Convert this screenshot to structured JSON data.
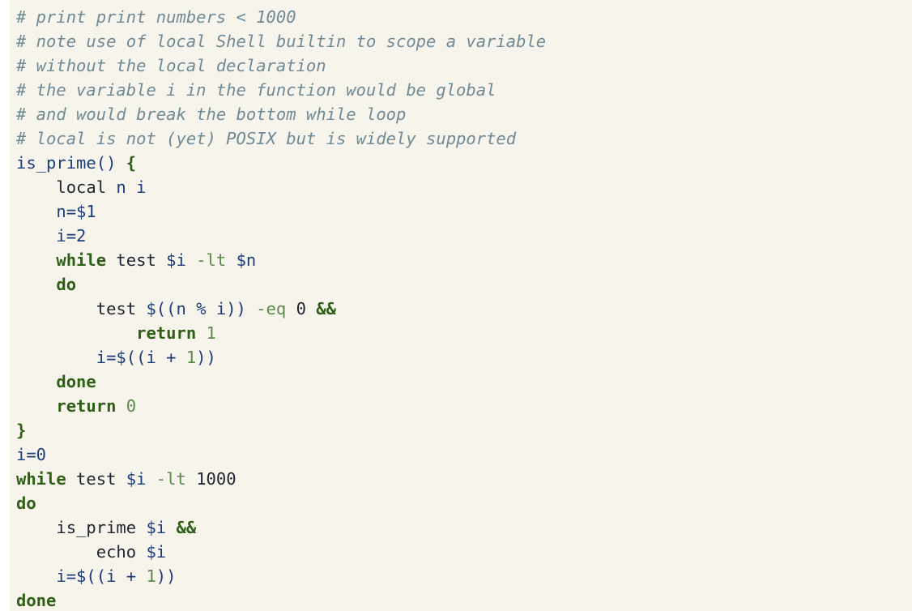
{
  "code": {
    "lines": [
      [
        {
          "t": "# print print numbers < 1000",
          "c": "comment"
        }
      ],
      [
        {
          "t": "# note use of local Shell builtin to scope a variable",
          "c": "comment"
        }
      ],
      [
        {
          "t": "# without the local declaration",
          "c": "comment"
        }
      ],
      [
        {
          "t": "# the variable i in the function would be global",
          "c": "comment"
        }
      ],
      [
        {
          "t": "# and would break the bottom while loop",
          "c": "comment"
        }
      ],
      [
        {
          "t": "# local is not (yet) POSIX but is widely supported",
          "c": "comment"
        }
      ],
      [
        {
          "t": "is_prime() ",
          "c": "fn"
        },
        {
          "t": "{",
          "c": "brace"
        }
      ],
      [
        {
          "t": "    local ",
          "c": "plain"
        },
        {
          "t": "n i",
          "c": "var"
        }
      ],
      [
        {
          "t": "    n=$1",
          "c": "var"
        }
      ],
      [
        {
          "t": "    i=2",
          "c": "var"
        }
      ],
      [
        {
          "t": "    ",
          "c": "plain"
        },
        {
          "t": "while",
          "c": "kw"
        },
        {
          "t": " test ",
          "c": "plain"
        },
        {
          "t": "$i",
          "c": "var"
        },
        {
          "t": " -lt ",
          "c": "op"
        },
        {
          "t": "$n",
          "c": "var"
        }
      ],
      [
        {
          "t": "    ",
          "c": "plain"
        },
        {
          "t": "do",
          "c": "kw"
        }
      ],
      [
        {
          "t": "        test ",
          "c": "plain"
        },
        {
          "t": "$((n % i))",
          "c": "var"
        },
        {
          "t": " -eq ",
          "c": "op"
        },
        {
          "t": "0 ",
          "c": "plain"
        },
        {
          "t": "&&",
          "c": "kw"
        }
      ],
      [
        {
          "t": "            ",
          "c": "plain"
        },
        {
          "t": "return",
          "c": "kw"
        },
        {
          "t": " 1",
          "c": "num"
        }
      ],
      [
        {
          "t": "        i=$((i + ",
          "c": "var"
        },
        {
          "t": "1",
          "c": "num"
        },
        {
          "t": "))",
          "c": "var"
        }
      ],
      [
        {
          "t": "    ",
          "c": "plain"
        },
        {
          "t": "done",
          "c": "kw"
        }
      ],
      [
        {
          "t": "    ",
          "c": "plain"
        },
        {
          "t": "return",
          "c": "kw"
        },
        {
          "t": " 0",
          "c": "num"
        }
      ],
      [
        {
          "t": "}",
          "c": "brace"
        }
      ],
      [
        {
          "t": "i=0",
          "c": "var"
        }
      ],
      [
        {
          "t": "while",
          "c": "kw"
        },
        {
          "t": " test ",
          "c": "plain"
        },
        {
          "t": "$i",
          "c": "var"
        },
        {
          "t": " -lt ",
          "c": "op"
        },
        {
          "t": "1000",
          "c": "plain"
        }
      ],
      [
        {
          "t": "do",
          "c": "kw"
        }
      ],
      [
        {
          "t": "    is_prime ",
          "c": "plain"
        },
        {
          "t": "$i",
          "c": "var"
        },
        {
          "t": " ",
          "c": "plain"
        },
        {
          "t": "&&",
          "c": "kw"
        }
      ],
      [
        {
          "t": "        echo ",
          "c": "plain"
        },
        {
          "t": "$i",
          "c": "var"
        }
      ],
      [
        {
          "t": "    i=$((i + ",
          "c": "var"
        },
        {
          "t": "1",
          "c": "num"
        },
        {
          "t": "))",
          "c": "var"
        }
      ],
      [
        {
          "t": "done",
          "c": "kw"
        }
      ]
    ]
  }
}
